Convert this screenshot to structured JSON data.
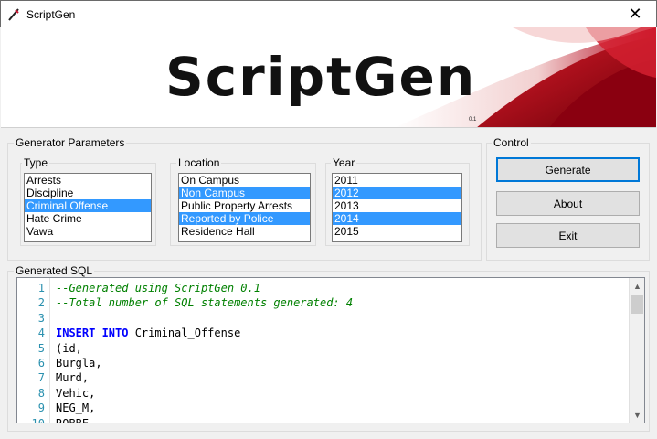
{
  "window": {
    "title": "ScriptGen",
    "close_glyph": "✕"
  },
  "banner": {
    "logo": "ScriptGen",
    "version": "0.1"
  },
  "generator_parameters": {
    "legend": "Generator Parameters",
    "type": {
      "label": "Type",
      "items": [
        {
          "text": "Arrests",
          "selected": false
        },
        {
          "text": "Discipline",
          "selected": false
        },
        {
          "text": "Criminal Offense",
          "selected": true
        },
        {
          "text": "Hate Crime",
          "selected": false
        },
        {
          "text": "Vawa",
          "selected": false
        }
      ]
    },
    "location": {
      "label": "Location",
      "items": [
        {
          "text": "On Campus",
          "selected": false
        },
        {
          "text": "Non Campus",
          "selected": true
        },
        {
          "text": "Public Property Arrests",
          "selected": false
        },
        {
          "text": "Reported by Police",
          "selected": true
        },
        {
          "text": "Residence Hall",
          "selected": false
        }
      ]
    },
    "year": {
      "label": "Year",
      "items": [
        {
          "text": "2011",
          "selected": false
        },
        {
          "text": "2012",
          "selected": true
        },
        {
          "text": "2013",
          "selected": false
        },
        {
          "text": "2014",
          "selected": true
        },
        {
          "text": "2015",
          "selected": false
        }
      ]
    }
  },
  "control": {
    "legend": "Control",
    "generate": "Generate",
    "about": "About",
    "exit": "Exit"
  },
  "generated_sql": {
    "legend": "Generated SQL",
    "lines": [
      {
        "n": "1",
        "parts": [
          {
            "t": "--Generated using ScriptGen 0.1",
            "k": "comment"
          }
        ]
      },
      {
        "n": "2",
        "parts": [
          {
            "t": "--Total number of SQL statements generated: 4",
            "k": "comment"
          }
        ]
      },
      {
        "n": "3",
        "parts": []
      },
      {
        "n": "4",
        "parts": [
          {
            "t": "INSERT INTO",
            "k": "keyword"
          },
          {
            "t": " Criminal_Offense",
            "k": "plain"
          }
        ]
      },
      {
        "n": "5",
        "parts": [
          {
            "t": "(id,",
            "k": "plain"
          }
        ]
      },
      {
        "n": "6",
        "parts": [
          {
            "t": "Burgla,",
            "k": "plain"
          }
        ]
      },
      {
        "n": "7",
        "parts": [
          {
            "t": "Murd,",
            "k": "plain"
          }
        ]
      },
      {
        "n": "8",
        "parts": [
          {
            "t": "Vehic,",
            "k": "plain"
          }
        ]
      },
      {
        "n": "9",
        "parts": [
          {
            "t": "NEG_M,",
            "k": "plain"
          }
        ]
      },
      {
        "n": "10",
        "parts": [
          {
            "t": "ROBBE",
            "k": "plain"
          }
        ]
      }
    ]
  },
  "icons": {
    "app": "scriptgen-app-icon",
    "close": "close-icon",
    "scroll_up": "chevron-up-icon",
    "scroll_down": "chevron-down-icon"
  },
  "colors": {
    "selection": "#3399ff",
    "comment": "#008000",
    "keyword": "#0000ff",
    "line_number": "#2b91af",
    "banner_accent": "#c8102e"
  }
}
